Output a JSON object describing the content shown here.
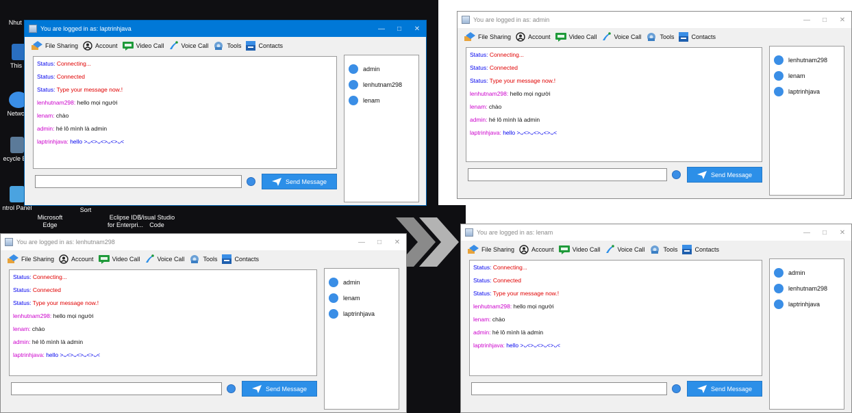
{
  "desktop": {
    "icons": [
      {
        "label": "Nhut Nam"
      },
      {
        "label": "This PC"
      },
      {
        "label": "Network"
      },
      {
        "label": "ecycle Bin"
      },
      {
        "label": "ntrol Panel"
      }
    ],
    "taskbar_apps": [
      {
        "label": "Microsoft\nEdge"
      },
      {
        "label": "Sort"
      },
      {
        "label": "Eclipse IDE\nfor Enterpri..."
      },
      {
        "label": "Visual Studio\nCode"
      }
    ]
  },
  "menu": {
    "file_sharing": "File Sharing",
    "account": "Account",
    "video_call": "Video Call",
    "voice_call": "Voice Call",
    "tools": "Tools",
    "contacts": "Contacts"
  },
  "send_label": "Send Message",
  "windows": [
    {
      "title": "You are logged in as: laptrinhjava",
      "messages": [
        {
          "who": "Status:",
          "text": " Connecting..."
        },
        {
          "who": "Status:",
          "text": " Connected"
        },
        {
          "who": "Status:",
          "text": " Type your message now.!"
        },
        {
          "who": "lenhutnam298:",
          "text": " hello mọi người"
        },
        {
          "who": "lenam:",
          "text": " chào"
        },
        {
          "who": "admin:",
          "text": " hé lô mình là admin"
        },
        {
          "who": "laptrinhjava:",
          "text": " hello >ᴗ<>ᴗ<>ᴗ<>ᴗ<"
        }
      ],
      "users": [
        "admin",
        "lenhutnam298",
        "lenam"
      ],
      "input_value": ""
    },
    {
      "title": "You are logged in as: admin",
      "messages": [
        {
          "who": "Status:",
          "text": " Connecting..."
        },
        {
          "who": "Status:",
          "text": " Connected"
        },
        {
          "who": "Status:",
          "text": " Type your message now.!"
        },
        {
          "who": "lenhutnam298:",
          "text": " hello mọi người"
        },
        {
          "who": "lenam:",
          "text": " chào"
        },
        {
          "who": "admin:",
          "text": " hé lô mình là admin"
        },
        {
          "who": "laptrinhjava:",
          "text": " hello >ᴗ<>ᴗ<>ᴗ<>ᴗ<"
        }
      ],
      "users": [
        "lenhutnam298",
        "lenam",
        "laptrinhjava"
      ],
      "input_value": ""
    },
    {
      "title": "You are logged in as: lenhutnam298",
      "messages": [
        {
          "who": "Status:",
          "text": " Connecting..."
        },
        {
          "who": "Status:",
          "text": " Connected"
        },
        {
          "who": "Status:",
          "text": " Type your message now.!"
        },
        {
          "who": "lenhutnam298:",
          "text": " hello mọi người"
        },
        {
          "who": "lenam:",
          "text": " chào"
        },
        {
          "who": "admin:",
          "text": " hé lô mình là admin"
        },
        {
          "who": "laptrinhjava:",
          "text": " hello >ᴗ<>ᴗ<>ᴗ<>ᴗ<"
        }
      ],
      "users": [
        "admin",
        "lenam",
        "laptrinhjava"
      ],
      "input_value": ""
    },
    {
      "title": "You are logged in as: lenam",
      "messages": [
        {
          "who": "Status:",
          "text": " Connecting..."
        },
        {
          "who": "Status:",
          "text": " Connected"
        },
        {
          "who": "Status:",
          "text": " Type your message now.!"
        },
        {
          "who": "lenhutnam298:",
          "text": " hello mọi người"
        },
        {
          "who": "lenam:",
          "text": " chào"
        },
        {
          "who": "admin:",
          "text": " hé lô mình là admin"
        },
        {
          "who": "laptrinhjava:",
          "text": " hello >ᴗ<>ᴗ<>ᴗ<>ᴗ<"
        }
      ],
      "users": [
        "admin",
        "lenhutnam298",
        "laptrinhjava"
      ],
      "input_value": ""
    }
  ]
}
